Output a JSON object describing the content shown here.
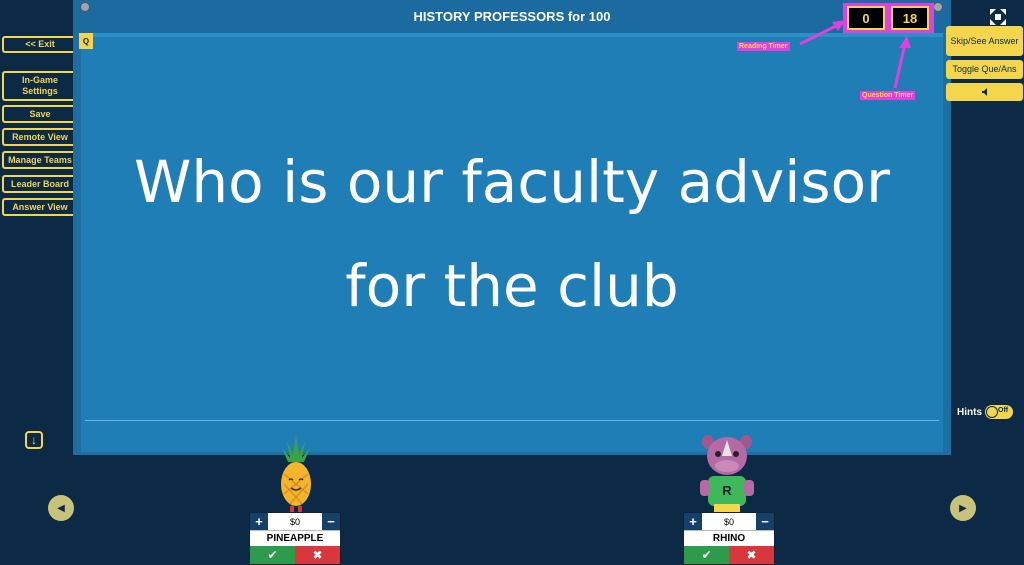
{
  "board": {
    "title": "HISTORY PROFESSORS for 100",
    "question": "Who is our faculty advisor for the club",
    "q_tag": "Q"
  },
  "left_menu": {
    "exit": "<< Exit",
    "settings": "In-Game Settings",
    "save": "Save",
    "remote": "Remote View",
    "teams": "Manage Teams",
    "leader": "Leader Board",
    "answer": "Answer View"
  },
  "timers": {
    "reading": "0",
    "question": "18",
    "reading_label": "Reading Timer",
    "question_label": "Question Timer"
  },
  "right_menu": {
    "skip": "Skip/See Answer",
    "toggle": "Toggle Que/Ans",
    "sound_icon": "speaker-icon"
  },
  "hints": {
    "label": "Hints",
    "state": "Off"
  },
  "teams": [
    {
      "name": "PINEAPPLE",
      "score": "$0"
    },
    {
      "name": "RHINO",
      "score": "$0"
    }
  ],
  "colors": {
    "accent": "#f3d64b",
    "background": "#0c2a45",
    "board": "#1f7eb5",
    "annotation": "#e040e0"
  }
}
